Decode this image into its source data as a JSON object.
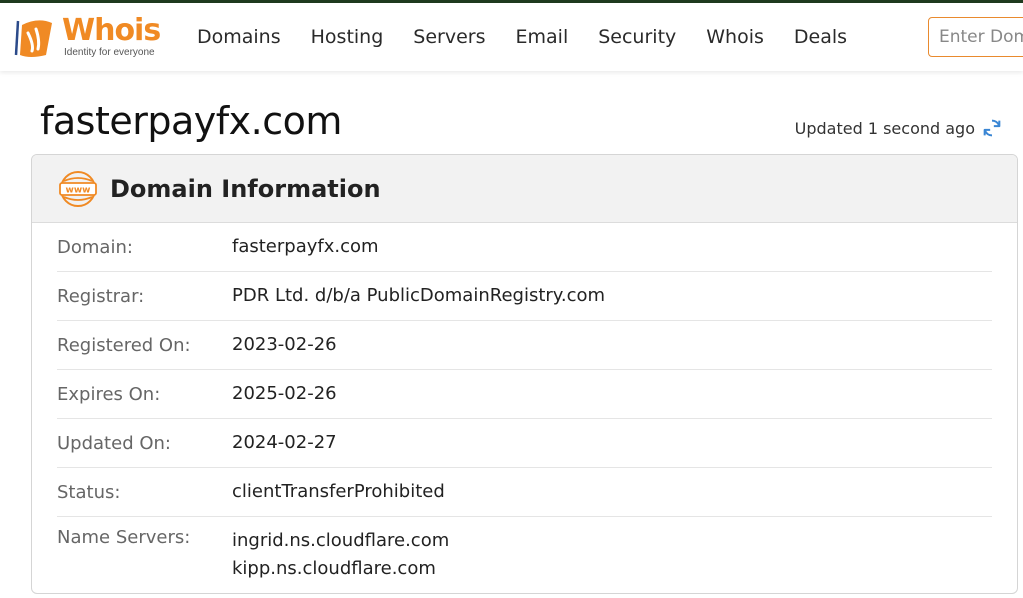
{
  "brand": {
    "name": "Whois",
    "tagline": "Identity for everyone",
    "color": "#f08a24"
  },
  "nav": {
    "items": [
      "Domains",
      "Hosting",
      "Servers",
      "Email",
      "Security",
      "Whois",
      "Deals"
    ]
  },
  "search": {
    "placeholder": "Enter Domain or IP"
  },
  "page": {
    "title": "fasterpayfx.com",
    "updated": "Updated 1 second ago"
  },
  "card": {
    "title": "Domain Information",
    "icon_text": "www",
    "rows": [
      {
        "label": "Domain:",
        "value": "fasterpayfx.com"
      },
      {
        "label": "Registrar:",
        "value": "PDR Ltd. d/b/a PublicDomainRegistry.com"
      },
      {
        "label": "Registered On:",
        "value": "2023-02-26"
      },
      {
        "label": "Expires On:",
        "value": "2025-02-26"
      },
      {
        "label": "Updated On:",
        "value": "2024-02-27"
      },
      {
        "label": "Status:",
        "value": "clientTransferProhibited"
      },
      {
        "label": "Name Servers:",
        "values": [
          "ingrid.ns.cloudflare.com",
          "kipp.ns.cloudflare.com"
        ]
      }
    ]
  },
  "icons": {
    "logo": "whois-logo-icon",
    "refresh": "refresh-icon",
    "www": "www-globe-icon"
  }
}
